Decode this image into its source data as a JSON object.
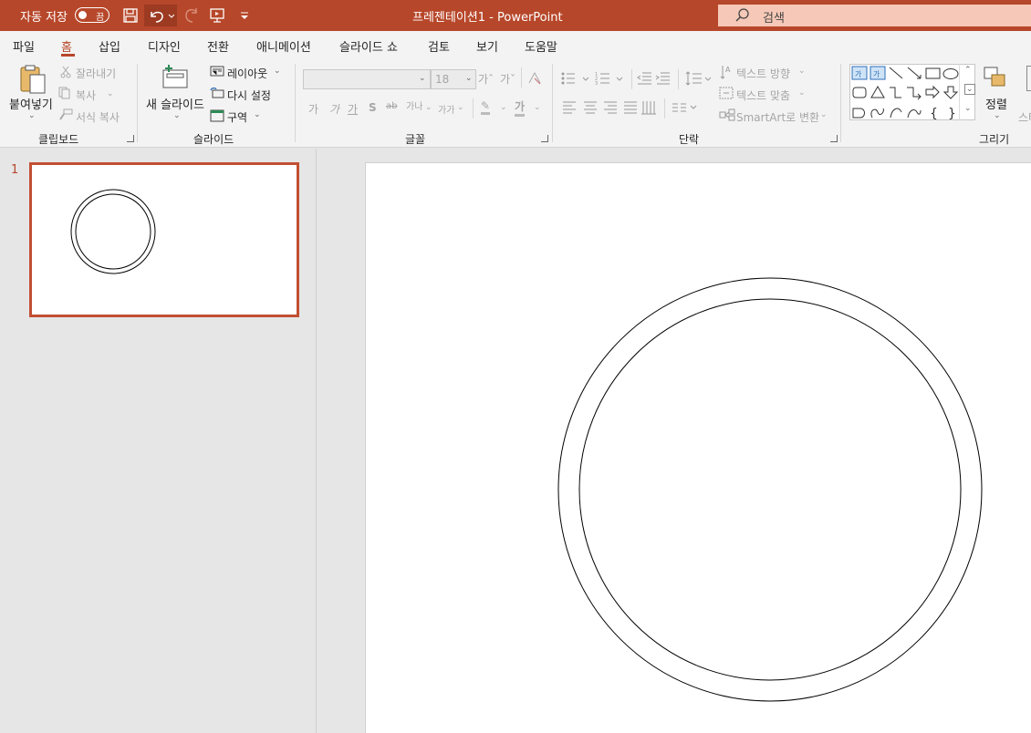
{
  "titlebar": {
    "autosave_label": "자동 저장",
    "autosave_state": "끔",
    "doc_title": "프레젠테이션1  -  PowerPoint",
    "search_label": "검색",
    "colors": {
      "bar": "#b7472a",
      "search_bg": "#f6c8b7"
    },
    "quick_access_icons": [
      "save-icon",
      "undo-icon",
      "redo-icon",
      "start-slideshow-icon",
      "customize-qat-icon"
    ]
  },
  "menu": {
    "tabs": [
      "파일",
      "홈",
      "삽입",
      "디자인",
      "전환",
      "애니메이션",
      "슬라이드 쇼",
      "검토",
      "보기",
      "도움말"
    ],
    "active": "홈"
  },
  "ribbon": {
    "clipboard": {
      "paste": "붙여넣기",
      "cut": "잘라내기",
      "copy": "복사",
      "format_painter": "서식 복사",
      "group_label": "클립보드"
    },
    "slides": {
      "new_slide": "새 슬라이드",
      "layout": "레이아웃",
      "reset": "다시 설정",
      "section": "구역",
      "group_label": "슬라이드"
    },
    "font": {
      "font_name": "",
      "font_size": "18",
      "grow": "가ˆ",
      "shrink": "가ˇ",
      "bold": "가",
      "italic": "가",
      "underline": "가",
      "shadow": "S",
      "strike": "ab",
      "spacing": "가나",
      "case": "가가",
      "highlight": "✎",
      "font_color": "가",
      "group_label": "글꼴"
    },
    "paragraph": {
      "text_direction": "텍스트 방향",
      "align_text": "텍스트 맞춤",
      "smartart": "SmartArt로 변환",
      "group_label": "단락"
    },
    "drawing": {
      "arrange": "정렬",
      "group_label": "그리기",
      "quick_styles_partial": "스타"
    }
  },
  "slides_panel": {
    "items": [
      {
        "number": "1"
      }
    ]
  }
}
